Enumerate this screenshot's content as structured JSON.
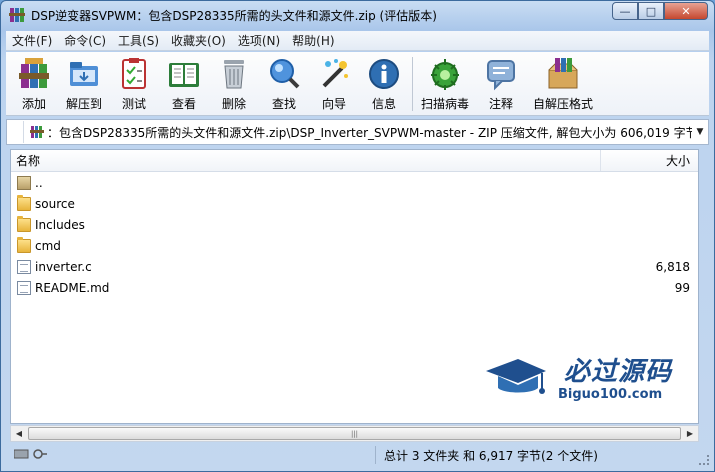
{
  "window": {
    "title": "DSP逆变器SVPWM：包含DSP28335所需的头文件和源文件.zip (评估版本)",
    "buttons": {
      "minimize": "—",
      "maximize": "□",
      "close": "✕"
    }
  },
  "menu": [
    "文件(F)",
    "命令(C)",
    "工具(S)",
    "收藏夹(O)",
    "选项(N)",
    "帮助(H)"
  ],
  "toolbar": [
    {
      "label": "添加",
      "icon": "add-archive-icon"
    },
    {
      "label": "解压到",
      "icon": "extract-to-icon"
    },
    {
      "label": "测试",
      "icon": "test-icon"
    },
    {
      "label": "查看",
      "icon": "view-book-icon"
    },
    {
      "label": "删除",
      "icon": "trash-icon"
    },
    {
      "label": "查找",
      "icon": "find-magnifier-icon"
    },
    {
      "label": "向导",
      "icon": "wizard-wand-icon"
    },
    {
      "label": "信息",
      "icon": "info-icon"
    },
    {
      "label": "扫描病毒",
      "icon": "virus-scan-icon"
    },
    {
      "label": "注释",
      "icon": "comment-icon"
    },
    {
      "label": "自解压格式",
      "icon": "sfx-box-icon"
    }
  ],
  "address": {
    "path": "：包含DSP28335所需的头文件和源文件.zip\\DSP_Inverter_SVPWM-master - ZIP 压缩文件, 解包大小为 606,019 字节"
  },
  "columns": {
    "name": "名称",
    "size": "大小"
  },
  "files": [
    {
      "name": "..",
      "size": "",
      "type": "updir"
    },
    {
      "name": "source",
      "size": "",
      "type": "folder"
    },
    {
      "name": "Includes",
      "size": "",
      "type": "folder"
    },
    {
      "name": "cmd",
      "size": "",
      "type": "folder"
    },
    {
      "name": "inverter.c",
      "size": "6,818",
      "type": "file"
    },
    {
      "name": "README.md",
      "size": "99",
      "type": "file"
    }
  ],
  "watermark": {
    "title": "必过源码",
    "subtitle": "Biguo100.com"
  },
  "status": {
    "text": "总计 3 文件夹 和 6,917 字节(2 个文件)"
  }
}
